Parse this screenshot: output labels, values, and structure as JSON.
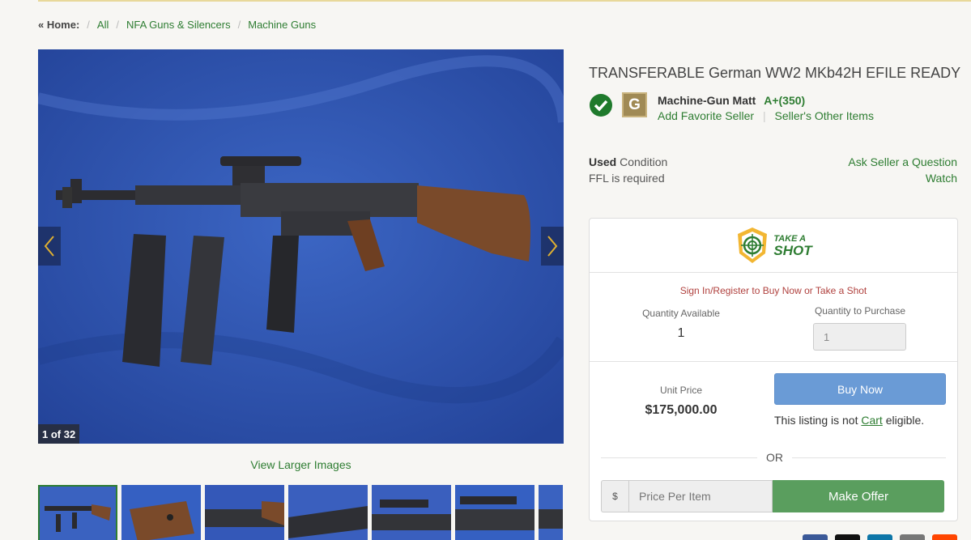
{
  "breadcrumb": {
    "home": "« Home:",
    "items": [
      "All",
      "NFA Guns & Silencers",
      "Machine Guns"
    ]
  },
  "gallery": {
    "counter": "1 of 32",
    "view_larger": "View Larger Images",
    "thumbnail_count": 7
  },
  "listing": {
    "title": "TRANSFERABLE German WW2 MKb42H EFILE READY",
    "seller_name": "Machine-Gun Matt",
    "seller_rating": "A+(350)",
    "grade_letter": "G",
    "add_favorite": "Add Favorite Seller",
    "other_items": "Seller's Other Items",
    "condition_label": "Used",
    "condition_suffix": "Condition",
    "ffl": "FFL is required",
    "ask_seller": "Ask Seller a Question",
    "watch": "Watch"
  },
  "buybox": {
    "take_a_shot_line1": "TAKE A",
    "take_a_shot_line2": "SHOT",
    "signin": "Sign In/Register to Buy Now or Take a Shot",
    "qty_available_label": "Quantity Available",
    "qty_available": "1",
    "qty_purchase_label": "Quantity to Purchase",
    "qty_purchase_value": "1",
    "unit_price_label": "Unit Price",
    "unit_price": "$175,000.00",
    "buy_now": "Buy Now",
    "cart_note_before": "This listing is not",
    "cart_link": "Cart",
    "cart_note_after": "eligible.",
    "or": "OR",
    "currency": "$",
    "offer_placeholder": "Price Per Item",
    "make_offer": "Make Offer"
  },
  "colors": {
    "link_green": "#2e7d32",
    "buy_blue": "#6a9bd6",
    "offer_green": "#5a9e5e",
    "signin_red": "#b0413e",
    "photo_blue": "#2f55b0"
  }
}
